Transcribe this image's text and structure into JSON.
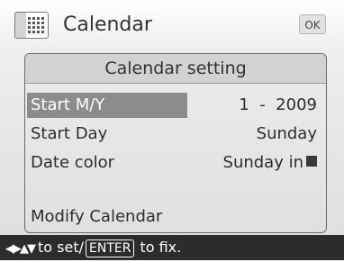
{
  "header": {
    "title": "Calendar",
    "ok_label": "OK",
    "icon": "calendar-icon"
  },
  "panel": {
    "title": "Calendar setting",
    "rows": [
      {
        "label": "Start M/Y",
        "value": "1  -  2009",
        "selected": true
      },
      {
        "label": "Start Day",
        "value": "Sunday"
      },
      {
        "label": "Date color",
        "value": "Sunday in",
        "swatch_color": "#3a3a3a"
      },
      {
        "label": "Modify Calendar",
        "value": ""
      }
    ]
  },
  "footer": {
    "arrows": "◀▶▲▼",
    "set_text": "to set/",
    "enter_key": "ENTER",
    "fix_text": "to fix."
  },
  "colors": {
    "highlight": "#8c8c8c",
    "footer_bg": "#2c2c2c"
  }
}
